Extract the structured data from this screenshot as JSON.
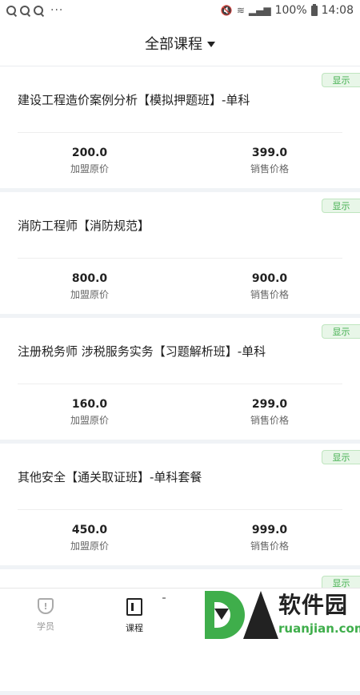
{
  "status_bar": {
    "dots": "···",
    "battery_percent": "100%",
    "time": "14:08"
  },
  "header": {
    "title": "全部课程"
  },
  "courses": [
    {
      "tag": "显示",
      "title": "建设工程造价案例分析【模拟押题班】-单科",
      "join_price": "200.0",
      "join_price_label": "加盟原价",
      "sale_price": "399.0",
      "sale_price_label": "销售价格"
    },
    {
      "tag": "显示",
      "title": "消防工程师【消防规范】",
      "join_price": "800.0",
      "join_price_label": "加盟原价",
      "sale_price": "900.0",
      "sale_price_label": "销售价格"
    },
    {
      "tag": "显示",
      "title": "注册税务师 涉税服务实务【习题解析班】-单科",
      "join_price": "160.0",
      "join_price_label": "加盟原价",
      "sale_price": "299.0",
      "sale_price_label": "销售价格"
    },
    {
      "tag": "显示",
      "title": "其他安全【通关取证班】-单科套餐",
      "join_price": "450.0",
      "join_price_label": "加盟原价",
      "sale_price": "999.0",
      "sale_price_label": "销售价格"
    },
    {
      "tag": "显示"
    }
  ],
  "bottom_nav": {
    "items": [
      {
        "label": "学员",
        "icon": "shield-icon",
        "active": false
      },
      {
        "label": "课程",
        "icon": "book-icon",
        "active": true
      }
    ]
  },
  "watermark": {
    "text": "软件园",
    "url": "ruanjian.com",
    "accent_color": "#3fae4b"
  },
  "colors": {
    "accent_green": "#3fae4b",
    "tag_bg": "#e8f6e8",
    "page_bg": "#f0f3f6"
  }
}
